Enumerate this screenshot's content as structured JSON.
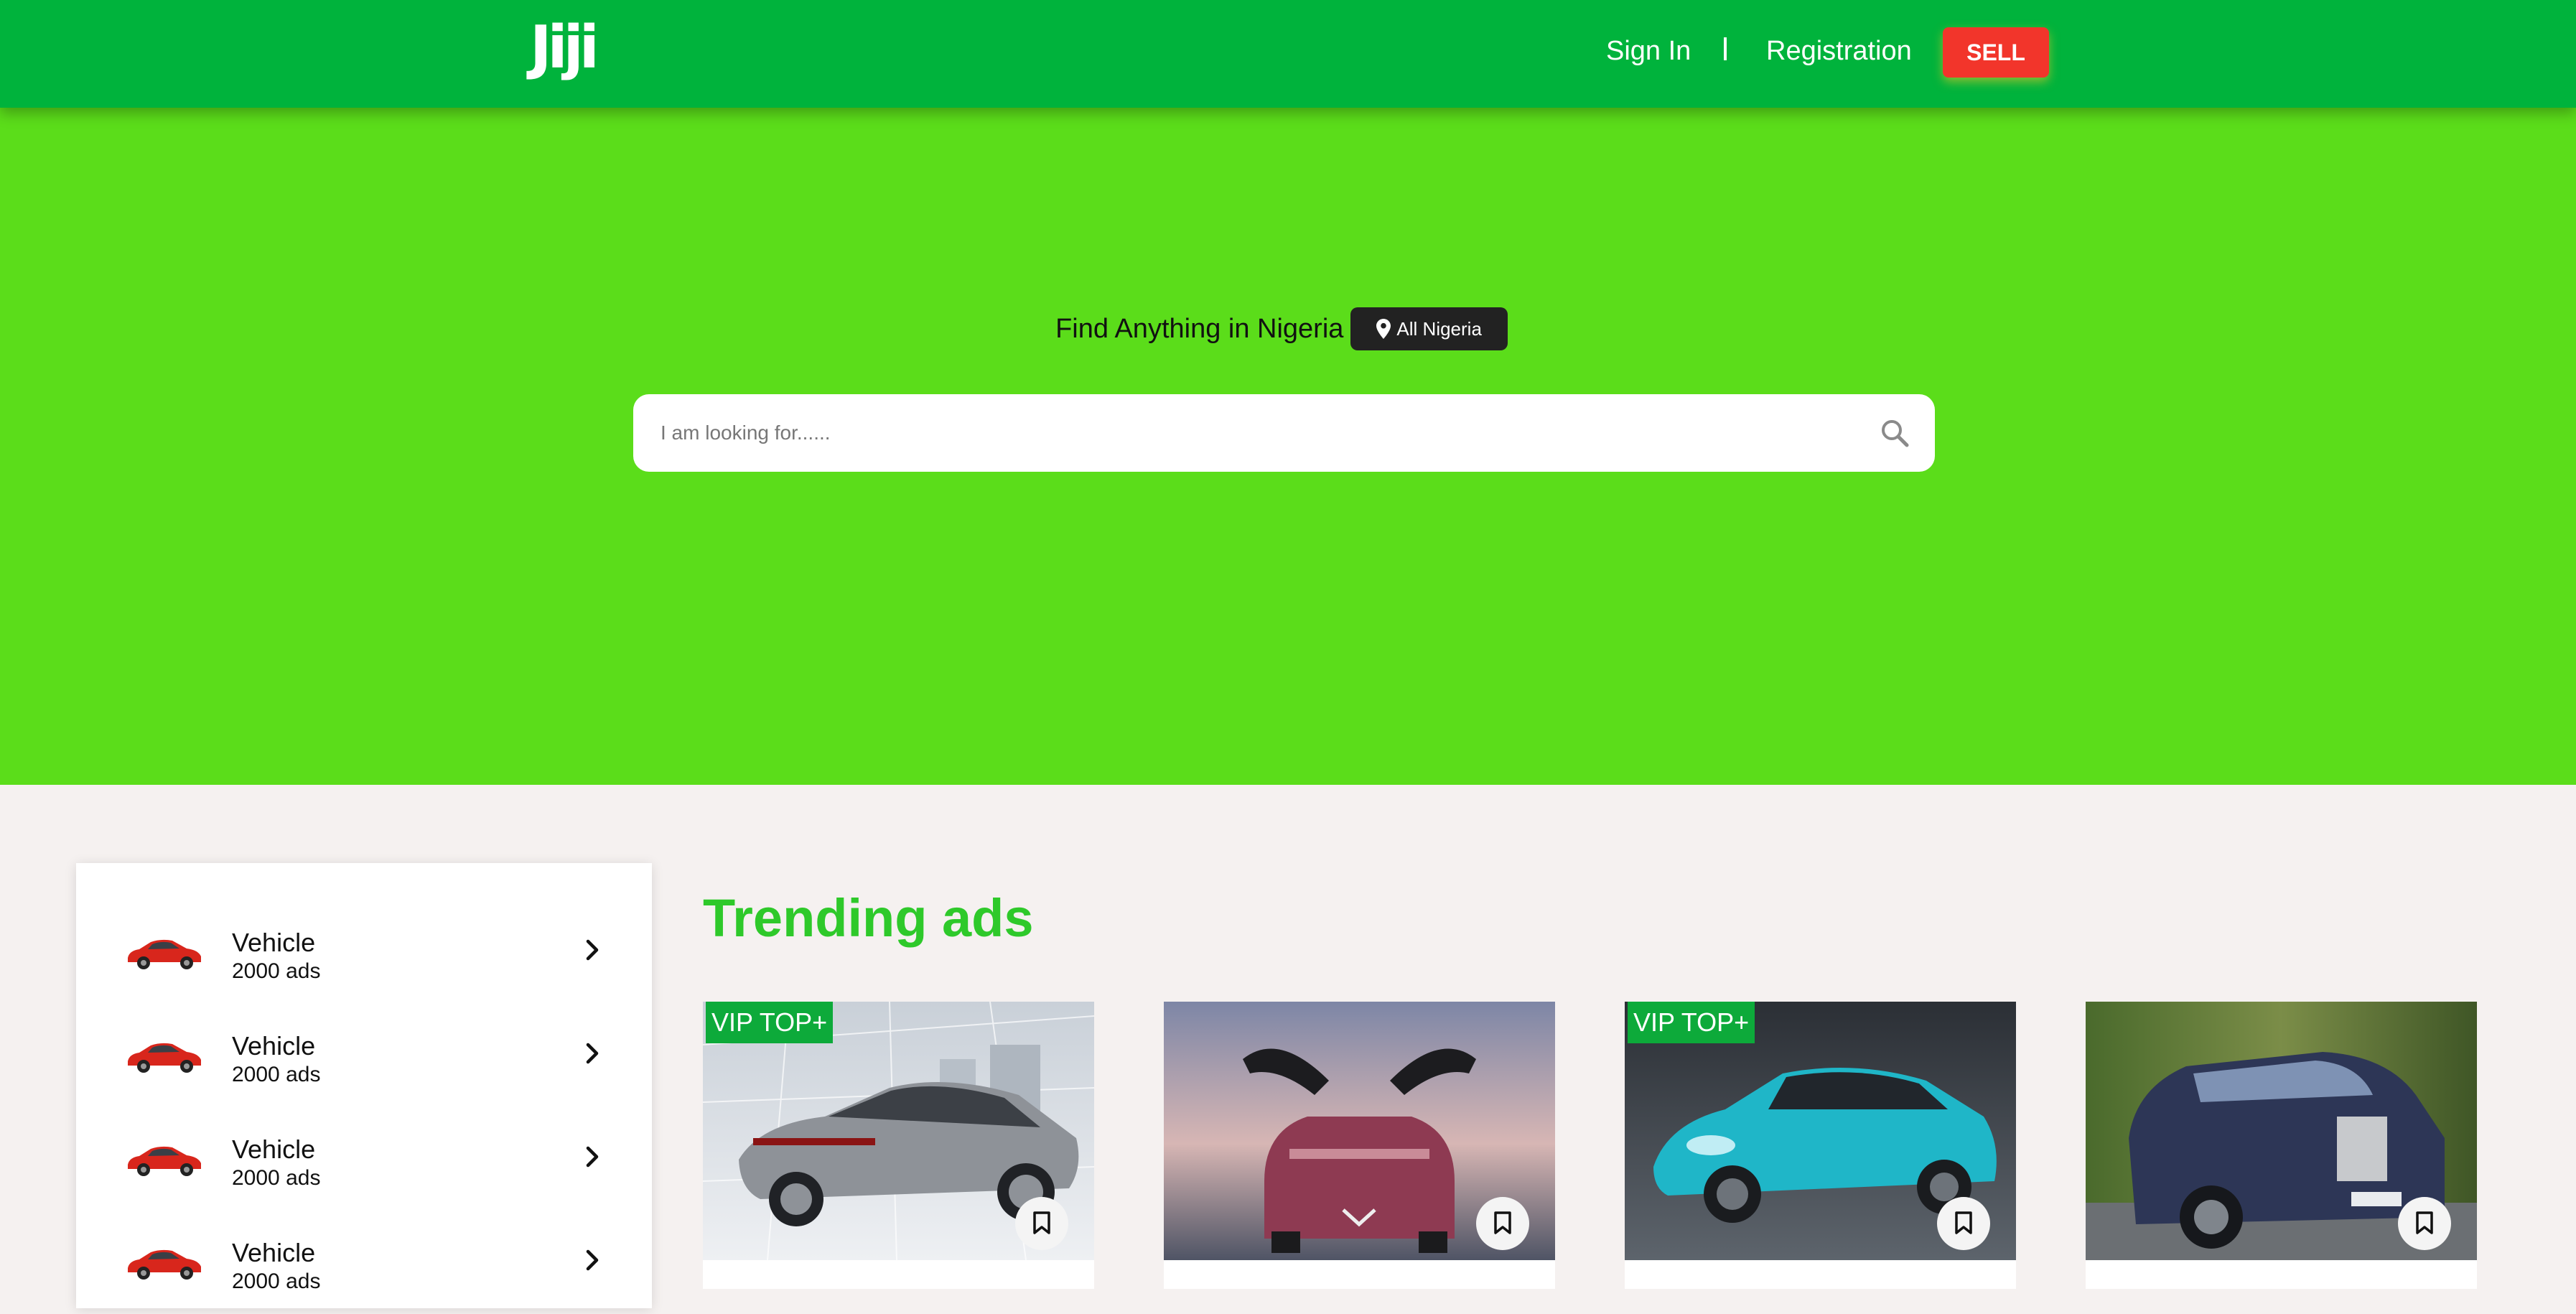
{
  "header": {
    "logo": "Jiji",
    "sign_in": "Sign In",
    "registration": "Registration",
    "sell": "SELL",
    "colors": {
      "bar": "#00b33c",
      "sell": "#f2352b"
    }
  },
  "hero": {
    "title": "Find Anything in Nigeria",
    "location": "All Nigeria",
    "search_placeholder": "I am looking for......",
    "background": "#5bdd1a"
  },
  "sidebar": {
    "items": [
      {
        "icon": "red-car-icon",
        "label": "Vehicle",
        "count": "2000 ads"
      },
      {
        "icon": "red-car-icon",
        "label": "Vehicle",
        "count": "2000 ads"
      },
      {
        "icon": "red-car-icon",
        "label": "Vehicle",
        "count": "2000 ads"
      },
      {
        "icon": "red-car-icon",
        "label": "Vehicle",
        "count": "2000 ads"
      }
    ]
  },
  "trending": {
    "title": "Trending ads",
    "ads": [
      {
        "badge": "VIP TOP+",
        "image": "silver-sedan-photo"
      },
      {
        "badge": "",
        "image": "pink-gullwing-car-photo"
      },
      {
        "badge": "VIP TOP+",
        "image": "teal-sedan-photo"
      },
      {
        "badge": "",
        "image": "blue-luxury-car-photo"
      }
    ]
  }
}
